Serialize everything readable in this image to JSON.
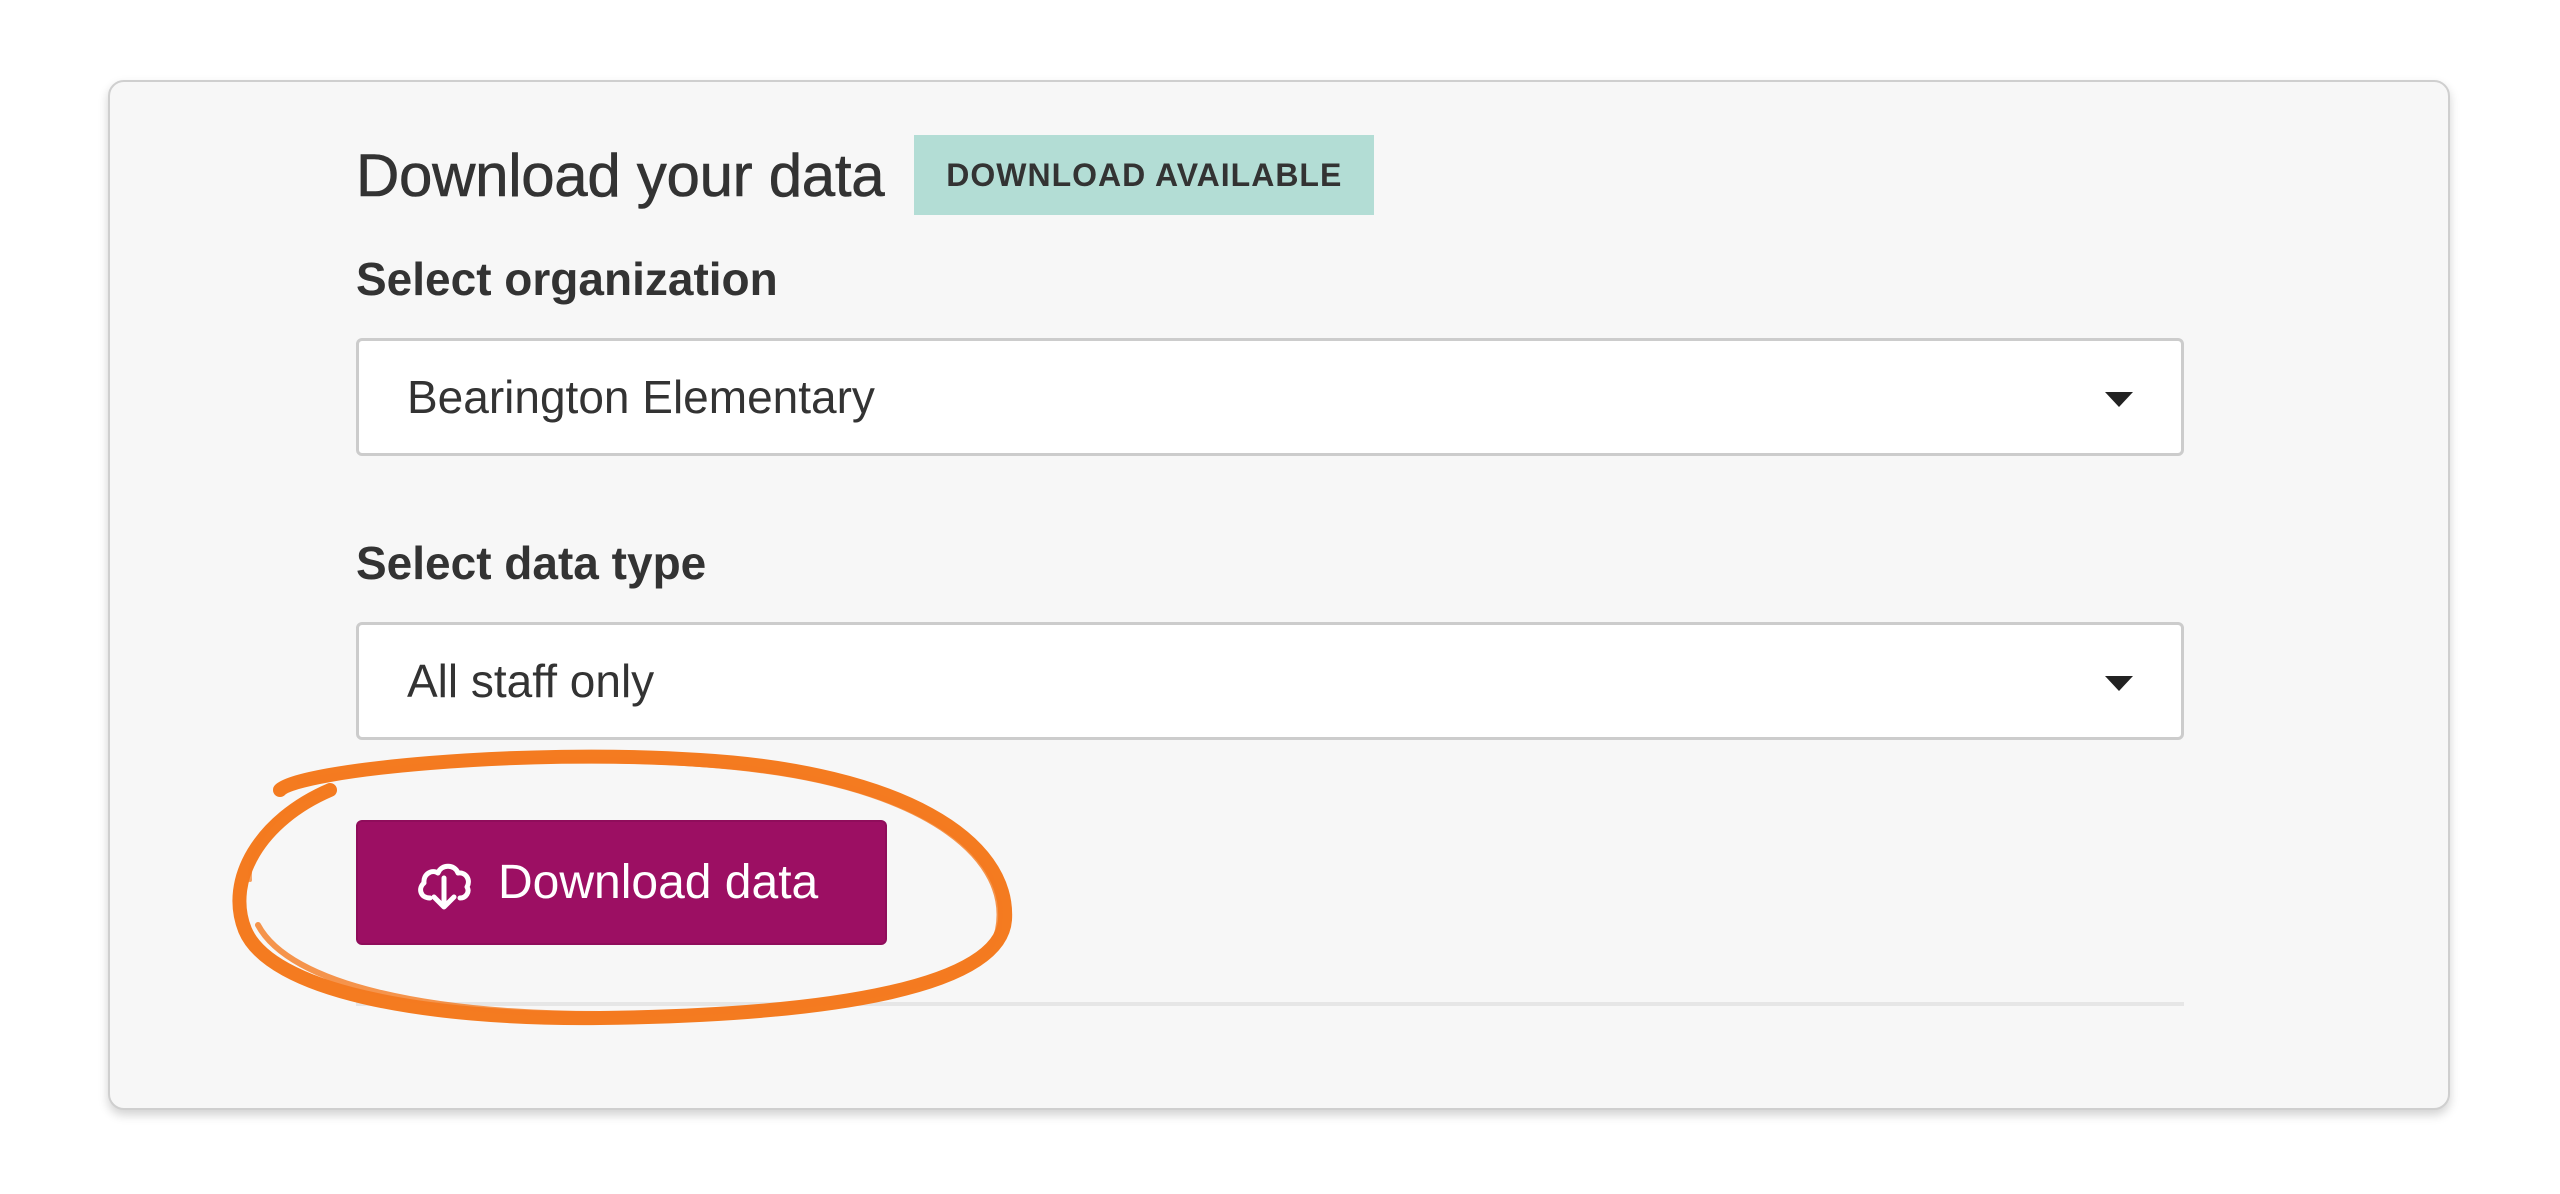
{
  "panel": {
    "title": "Download your data",
    "badge": "DOWNLOAD AVAILABLE"
  },
  "organization": {
    "label": "Select organization",
    "value": "Bearington Elementary"
  },
  "data_type": {
    "label": "Select data type",
    "value": "All staff only"
  },
  "download_button": {
    "label": "Download data",
    "icon": "cloud-download-icon"
  },
  "colors": {
    "badge_bg": "#b3ddd5",
    "button_bg": "#9c0f63",
    "highlight": "#f47b20"
  }
}
